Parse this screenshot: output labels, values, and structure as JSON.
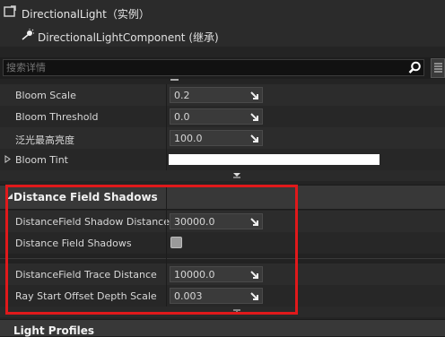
{
  "header": {
    "title": "DirectionalLight（实例）",
    "component": "DirectionalLightComponent (继承)"
  },
  "search": {
    "placeholder": "搜索详情"
  },
  "rows_top": [
    {
      "label": "Bloom Scale",
      "value": "0.2"
    },
    {
      "label": "Bloom Threshold",
      "value": "0.0"
    },
    {
      "label": "泛光最高亮度",
      "value": "100.0"
    },
    {
      "label": "Bloom Tint",
      "value": ""
    }
  ],
  "dfs": {
    "title": "Distance Field Shadows",
    "shadow_distance": {
      "label": "DistanceField Shadow Distance",
      "value": "30000.0"
    },
    "shadows_toggle": {
      "label": "Distance Field Shadows",
      "checked": false
    },
    "trace_distance": {
      "label": "DistanceField Trace Distance",
      "value": "10000.0"
    },
    "ray_offset": {
      "label": "Ray Start Offset Depth Scale",
      "value": "0.003"
    }
  },
  "next_category": "Light Profiles",
  "colors": {
    "highlight": "#e0191b",
    "bloom_tint": "#ffffff"
  }
}
